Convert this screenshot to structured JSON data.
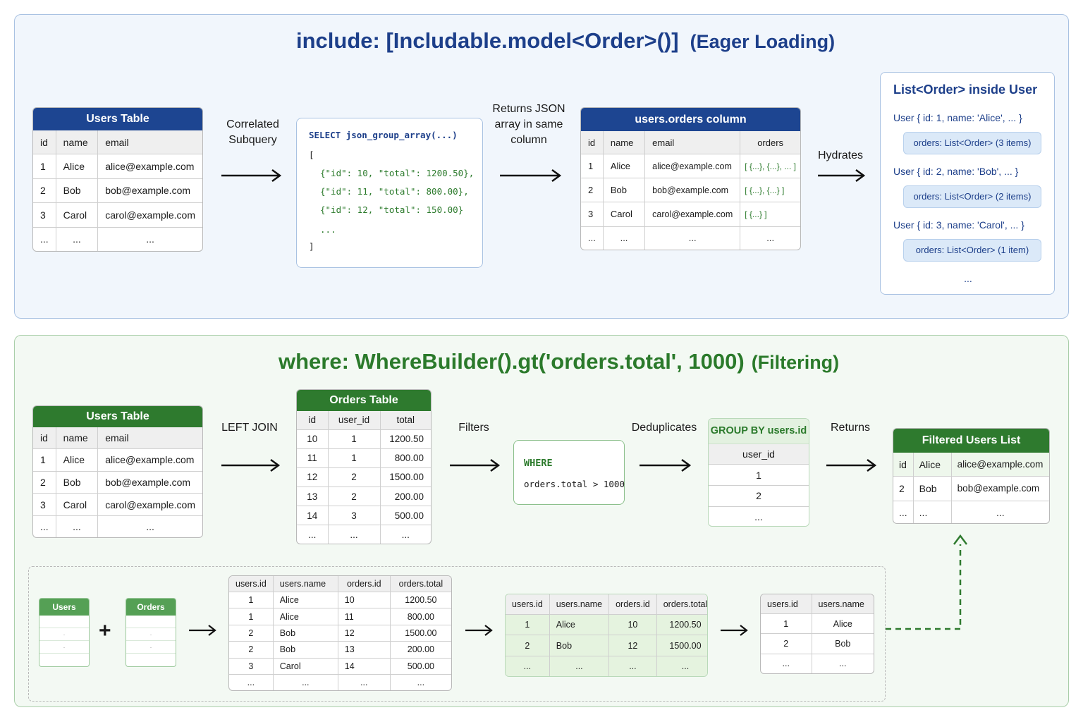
{
  "top": {
    "title": "include: [Includable.model<Order>()]",
    "subtitle": "(Eager Loading)",
    "users_table": {
      "title": "Users Table",
      "headers": [
        "id",
        "name",
        "email"
      ],
      "rows": [
        [
          "1",
          "Alice",
          "alice@example.com"
        ],
        [
          "2",
          "Bob",
          "bob@example.com"
        ],
        [
          "3",
          "Carol",
          "carol@example.com"
        ],
        [
          "...",
          "...",
          "..."
        ]
      ]
    },
    "label_correlated": [
      "Correlated",
      "Subquery"
    ],
    "json_box": {
      "line1_kw": "SELECT",
      "line1_fn": "json_group_array(...)",
      "open": "[",
      "items": [
        "{\"id\": 10, \"total\": 1200.50},",
        "{\"id\": 11, \"total\": 800.00},",
        "{\"id\": 12, \"total\": 150.00}"
      ],
      "ellipsis": "...",
      "close": "]"
    },
    "label_returns": [
      "Returns JSON",
      "array in same",
      "column"
    ],
    "orders_column_table": {
      "title": "users.orders column",
      "headers": [
        "id",
        "name",
        "email",
        "orders"
      ],
      "rows": [
        [
          "1",
          "Alice",
          "alice@example.com",
          "[ {...}, {...}, ... ]"
        ],
        [
          "2",
          "Bob",
          "bob@example.com",
          "[ {...}, {...} ]"
        ],
        [
          "3",
          "Carol",
          "carol@example.com",
          "[ {...} ]"
        ],
        [
          "...",
          "...",
          "...",
          "..."
        ]
      ]
    },
    "label_hydrates": "Hydrates",
    "list_box": {
      "title": "List<Order> inside User",
      "entries": [
        {
          "user": "User { id: 1, name: 'Alice', ... }",
          "orders": "orders: List<Order> (3 items)"
        },
        {
          "user": "User { id: 2, name: 'Bob', ... }",
          "orders": "orders: List<Order> (2 items)"
        },
        {
          "user": "User { id: 3, name: 'Carol', ... }",
          "orders": "orders: List<Order> (1 item)"
        }
      ],
      "ellipsis": "..."
    }
  },
  "bottom": {
    "title": "where: WhereBuilder().gt('orders.total', 1000)",
    "subtitle": "(Filtering)",
    "users_table": {
      "title": "Users Table",
      "headers": [
        "id",
        "name",
        "email"
      ],
      "rows": [
        [
          "1",
          "Alice",
          "alice@example.com"
        ],
        [
          "2",
          "Bob",
          "bob@example.com"
        ],
        [
          "3",
          "Carol",
          "carol@example.com"
        ],
        [
          "...",
          "...",
          "..."
        ]
      ]
    },
    "label_left_join": "LEFT JOIN",
    "orders_table": {
      "title": "Orders Table",
      "headers": [
        "id",
        "user_id",
        "total"
      ],
      "rows": [
        [
          "10",
          "1",
          "1200.50"
        ],
        [
          "11",
          "1",
          "800.00"
        ],
        [
          "12",
          "2",
          "1500.00"
        ],
        [
          "13",
          "2",
          "200.00"
        ],
        [
          "14",
          "3",
          "500.00"
        ],
        [
          "...",
          "...",
          "..."
        ]
      ]
    },
    "label_filters": "Filters",
    "where_box": {
      "keyword": "WHERE",
      "condition": "orders.total > 1000"
    },
    "label_dedup": "Deduplicates",
    "group_box": {
      "title": "GROUP BY users.id",
      "header": "user_id",
      "rows": [
        "1",
        "2",
        "..."
      ]
    },
    "label_returns": "Returns",
    "filtered": {
      "title": "Filtered Users List",
      "rows": [
        [
          "id",
          "Alice",
          "alice@example.com"
        ],
        [
          "2",
          "Bob",
          "bob@example.com"
        ],
        [
          "...",
          "...",
          "..."
        ]
      ]
    },
    "detail": {
      "mini_users": "Users",
      "mini_orders": "Orders",
      "plus": "+",
      "joined": {
        "headers": [
          "users.id",
          "users.name",
          "orders.id",
          "orders.total"
        ],
        "rows": [
          [
            "1",
            "Alice",
            "10",
            "1200.50"
          ],
          [
            "1",
            "Alice",
            "11",
            "800.00"
          ],
          [
            "2",
            "Bob",
            "12",
            "1500.00"
          ],
          [
            "2",
            "Bob",
            "13",
            "200.00"
          ],
          [
            "3",
            "Carol",
            "14",
            "500.00"
          ],
          [
            "...",
            "...",
            "...",
            "..."
          ]
        ]
      },
      "filtered": {
        "headers": [
          "users.id",
          "users.name",
          "orders.id",
          "orders.total"
        ],
        "rows": [
          [
            "1",
            "Alice",
            "10",
            "1200.50"
          ],
          [
            "2",
            "Bob",
            "12",
            "1500.00"
          ],
          [
            "...",
            "...",
            "...",
            "..."
          ]
        ]
      },
      "result": {
        "headers": [
          "users.id",
          "users.name"
        ],
        "rows": [
          [
            "1",
            "Alice"
          ],
          [
            "2",
            "Bob"
          ],
          [
            "...",
            "..."
          ]
        ]
      }
    }
  },
  "colors": {
    "navy": "#1d4591",
    "green": "#2e7a2e",
    "blue_panel": "#f1f6fc",
    "green_panel": "#f3f9f3"
  }
}
